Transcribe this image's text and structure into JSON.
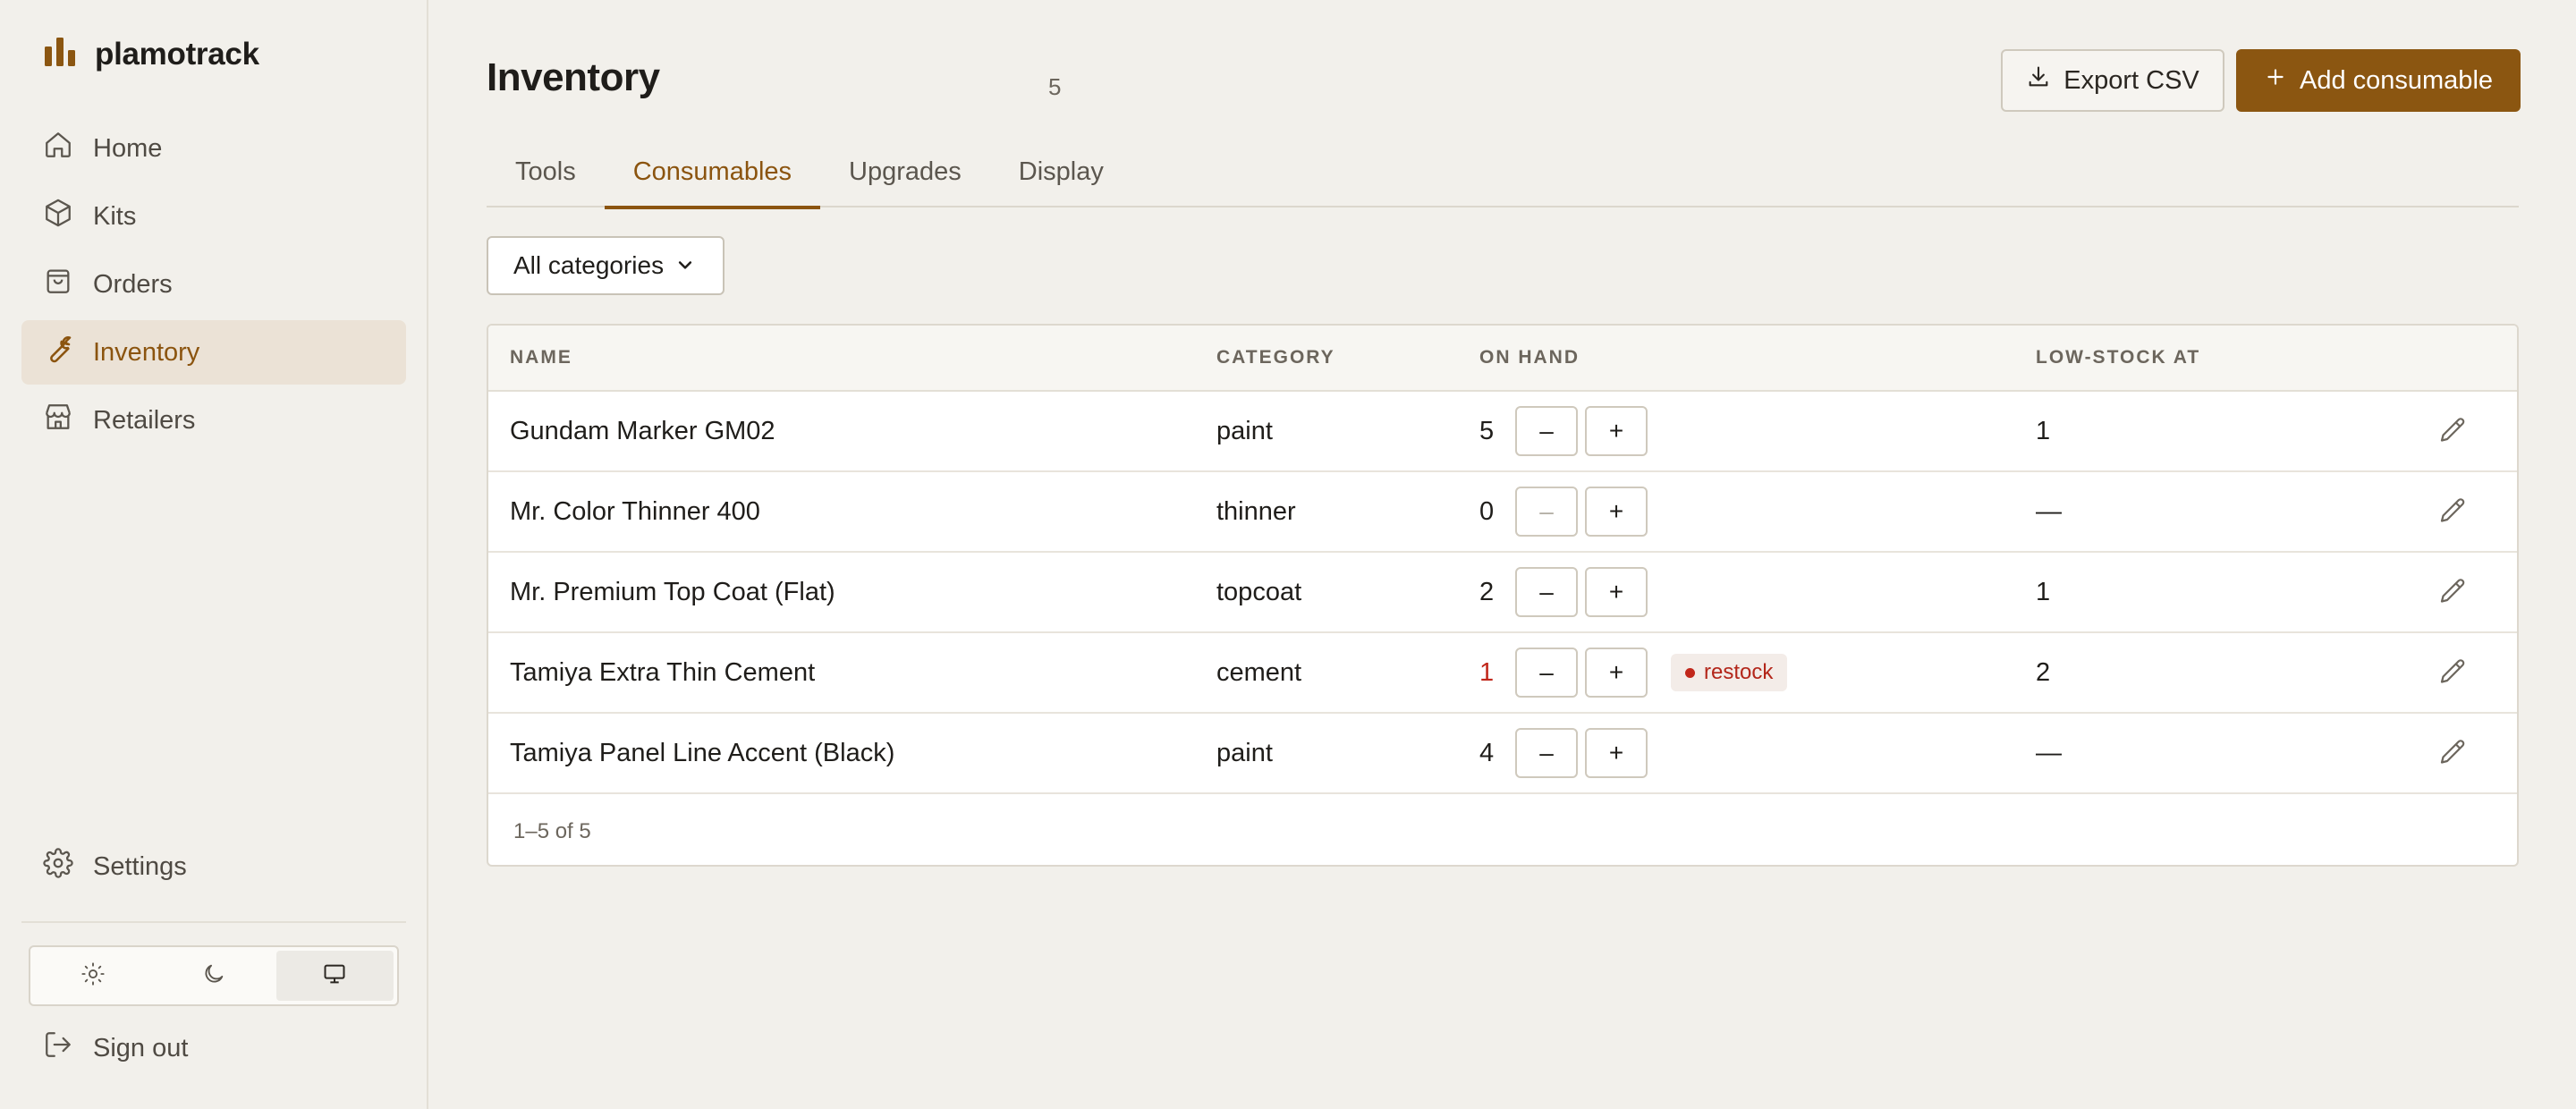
{
  "app": {
    "name": "plamotrack"
  },
  "sidebar": {
    "items": [
      {
        "label": "Home",
        "icon": "home-icon"
      },
      {
        "label": "Kits",
        "icon": "box-icon"
      },
      {
        "label": "Orders",
        "icon": "bag-icon"
      },
      {
        "label": "Inventory",
        "icon": "wrench-icon",
        "active": true
      },
      {
        "label": "Retailers",
        "icon": "store-icon"
      }
    ],
    "settings_label": "Settings",
    "signout_label": "Sign out",
    "theme": {
      "options": [
        "light",
        "dark",
        "system"
      ],
      "selected": "system"
    }
  },
  "page": {
    "title": "Inventory",
    "count": "5"
  },
  "actions": {
    "export_label": "Export CSV",
    "add_label": "Add consumable"
  },
  "tabs": [
    {
      "label": "Tools"
    },
    {
      "label": "Consumables",
      "active": true
    },
    {
      "label": "Upgrades"
    },
    {
      "label": "Display"
    }
  ],
  "filter": {
    "selected": "All categories"
  },
  "table": {
    "headers": {
      "name": "NAME",
      "category": "CATEGORY",
      "on_hand": "ON HAND",
      "low_stock": "LOW-STOCK AT"
    },
    "rows": [
      {
        "name": "Gundam Marker GM02",
        "category": "paint",
        "on_hand": "5",
        "low_stock_at": "1",
        "restock": false,
        "decrement_disabled": false
      },
      {
        "name": "Mr. Color Thinner 400",
        "category": "thinner",
        "on_hand": "0",
        "low_stock_at": "—",
        "restock": false,
        "decrement_disabled": true
      },
      {
        "name": "Mr. Premium Top Coat (Flat)",
        "category": "topcoat",
        "on_hand": "2",
        "low_stock_at": "1",
        "restock": false,
        "decrement_disabled": false
      },
      {
        "name": "Tamiya Extra Thin Cement",
        "category": "cement",
        "on_hand": "1",
        "low_stock_at": "2",
        "restock": true,
        "restock_label": "restock",
        "decrement_disabled": false
      },
      {
        "name": "Tamiya Panel Line Accent (Black)",
        "category": "paint",
        "on_hand": "4",
        "low_stock_at": "—",
        "restock": false,
        "decrement_disabled": false
      }
    ],
    "stepper": {
      "minus": "–",
      "plus": "+"
    },
    "footer": "1–5 of 5"
  },
  "colors": {
    "accent": "#8b5611",
    "low": "#c1271b",
    "background": "#f2f0eb"
  }
}
